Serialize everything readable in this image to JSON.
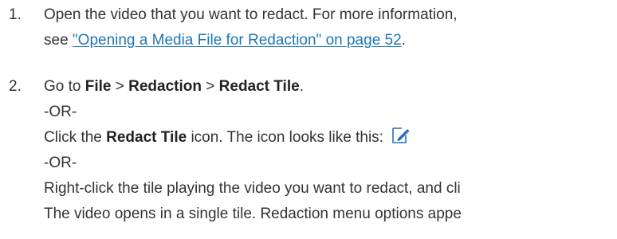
{
  "steps": [
    {
      "number": "1.",
      "line1": "Open the video that you want to redact. For more information,",
      "line2_prefix": "see ",
      "link_text": "\"Opening a Media File for Redaction\" on page 52",
      "line2_suffix": "."
    },
    {
      "number": "2.",
      "goto_prefix": "Go to ",
      "menu_file": "File",
      "sep1": " > ",
      "menu_redaction": "Redaction",
      "sep2": " > ",
      "menu_redact_tile": "Redact Tile",
      "goto_suffix": ".",
      "or1": "-OR-",
      "click_prefix": "Click the ",
      "click_bold": "Redact Tile",
      "click_suffix": " icon. The icon looks like this: ",
      "icon_name": "redact-tile-icon",
      "or2": "-OR-",
      "line_rightclick": "Right-click the tile playing the video you want to redact, and cli",
      "line_opens": "The video opens in a single tile. Redaction menu options appe"
    }
  ],
  "colors": {
    "text": "#333333",
    "link": "#1f76b8",
    "icon_blue": "#2a6fb6"
  }
}
